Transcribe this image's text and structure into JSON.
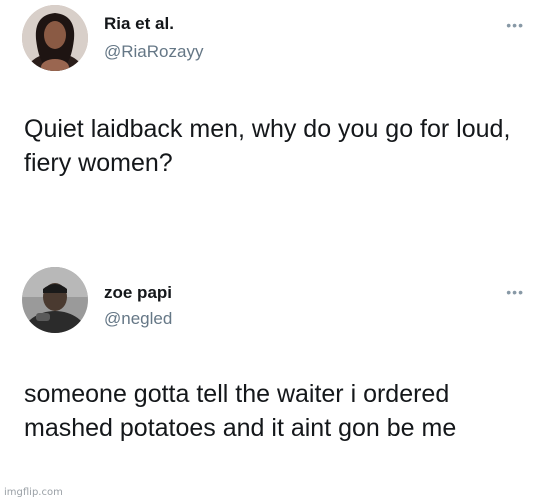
{
  "tweets": [
    {
      "display_name": "Ria et al.",
      "handle": "@RiaRozayy",
      "text": "Quiet laidback men, why do you go for loud, fiery women?",
      "more_icon": "more-options-icon"
    },
    {
      "display_name": "zoe papi",
      "handle": "@negled",
      "text": "someone gotta tell the waiter i ordered mashed potatoes and it aint gon be me",
      "more_icon": "more-options-icon"
    }
  ],
  "watermark": "imgflip.com"
}
